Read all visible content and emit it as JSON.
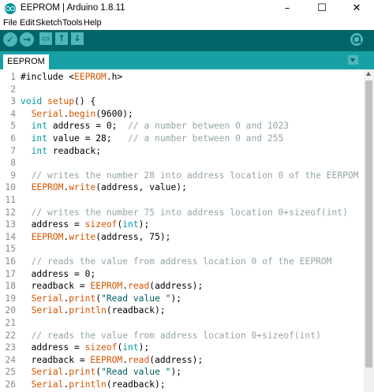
{
  "window": {
    "title": "EEPROM | Arduino 1.8.11",
    "minimize": "–",
    "maximize": "☐",
    "close": "✕"
  },
  "menu": [
    "File",
    "Edit",
    "Sketch",
    "Tools",
    "Help"
  ],
  "toolbar": {
    "verify_icon": "✓",
    "upload_icon": "→",
    "new_icon": "▭",
    "open_icon": "↑",
    "save_icon": "↓"
  },
  "tabs": [
    {
      "label": "EEPROM"
    }
  ],
  "colors": {
    "keyword": "#d35400",
    "type": "#00979c",
    "comment": "#95a5a6",
    "string": "#005c5f",
    "text": "#000000"
  },
  "code_lines": [
    [
      [
        "t",
        "#include <"
      ],
      [
        "k",
        "EEPROM"
      ],
      [
        "t",
        ".h>"
      ]
    ],
    [],
    [
      [
        "y",
        "void"
      ],
      [
        "t",
        " "
      ],
      [
        "k",
        "setup"
      ],
      [
        "t",
        "() {"
      ]
    ],
    [
      [
        "t",
        "  "
      ],
      [
        "k",
        "Serial"
      ],
      [
        "t",
        "."
      ],
      [
        "k",
        "begin"
      ],
      [
        "t",
        "(9600);"
      ]
    ],
    [
      [
        "t",
        "  "
      ],
      [
        "y",
        "int"
      ],
      [
        "t",
        " address = 0;  "
      ],
      [
        "c",
        "// a number between 0 and 1023"
      ]
    ],
    [
      [
        "t",
        "  "
      ],
      [
        "y",
        "int"
      ],
      [
        "t",
        " value = 28;   "
      ],
      [
        "c",
        "// a number between 0 and 255"
      ]
    ],
    [
      [
        "t",
        "  "
      ],
      [
        "y",
        "int"
      ],
      [
        "t",
        " readback;"
      ]
    ],
    [],
    [
      [
        "t",
        "  "
      ],
      [
        "c",
        "// writes the number 28 into address location 0 of the EERPOM"
      ]
    ],
    [
      [
        "t",
        "  "
      ],
      [
        "k",
        "EEPROM"
      ],
      [
        "t",
        "."
      ],
      [
        "k",
        "write"
      ],
      [
        "t",
        "(address, value);"
      ]
    ],
    [],
    [
      [
        "t",
        "  "
      ],
      [
        "c",
        "// writes the number 75 into address location 0+sizeof(int)"
      ]
    ],
    [
      [
        "t",
        "  address = "
      ],
      [
        "k",
        "sizeof"
      ],
      [
        "t",
        "("
      ],
      [
        "y",
        "int"
      ],
      [
        "t",
        ");"
      ]
    ],
    [
      [
        "t",
        "  "
      ],
      [
        "k",
        "EEPROM"
      ],
      [
        "t",
        "."
      ],
      [
        "k",
        "write"
      ],
      [
        "t",
        "(address, 75);"
      ]
    ],
    [],
    [
      [
        "t",
        "  "
      ],
      [
        "c",
        "// reads the value from address location 0 of the EEPROM"
      ]
    ],
    [
      [
        "t",
        "  address = 0;"
      ]
    ],
    [
      [
        "t",
        "  readback = "
      ],
      [
        "k",
        "EEPROM"
      ],
      [
        "t",
        "."
      ],
      [
        "k",
        "read"
      ],
      [
        "t",
        "(address);"
      ]
    ],
    [
      [
        "t",
        "  "
      ],
      [
        "k",
        "Serial"
      ],
      [
        "t",
        "."
      ],
      [
        "k",
        "print"
      ],
      [
        "t",
        "("
      ],
      [
        "s",
        "\"Read value \""
      ],
      [
        "t",
        ");"
      ]
    ],
    [
      [
        "t",
        "  "
      ],
      [
        "k",
        "Serial"
      ],
      [
        "t",
        "."
      ],
      [
        "k",
        "println"
      ],
      [
        "t",
        "(readback);"
      ]
    ],
    [],
    [
      [
        "t",
        "  "
      ],
      [
        "c",
        "// reads the value from address location 0+sizeof(int)"
      ]
    ],
    [
      [
        "t",
        "  address = "
      ],
      [
        "k",
        "sizeof"
      ],
      [
        "t",
        "("
      ],
      [
        "y",
        "int"
      ],
      [
        "t",
        ");"
      ]
    ],
    [
      [
        "t",
        "  readback = "
      ],
      [
        "k",
        "EEPROM"
      ],
      [
        "t",
        "."
      ],
      [
        "k",
        "read"
      ],
      [
        "t",
        "(address);"
      ]
    ],
    [
      [
        "t",
        "  "
      ],
      [
        "k",
        "Serial"
      ],
      [
        "t",
        "."
      ],
      [
        "k",
        "print"
      ],
      [
        "t",
        "("
      ],
      [
        "s",
        "\"Read value \""
      ],
      [
        "t",
        ");"
      ]
    ],
    [
      [
        "t",
        "  "
      ],
      [
        "k",
        "Serial"
      ],
      [
        "t",
        "."
      ],
      [
        "k",
        "println"
      ],
      [
        "t",
        "(readback);"
      ]
    ]
  ]
}
